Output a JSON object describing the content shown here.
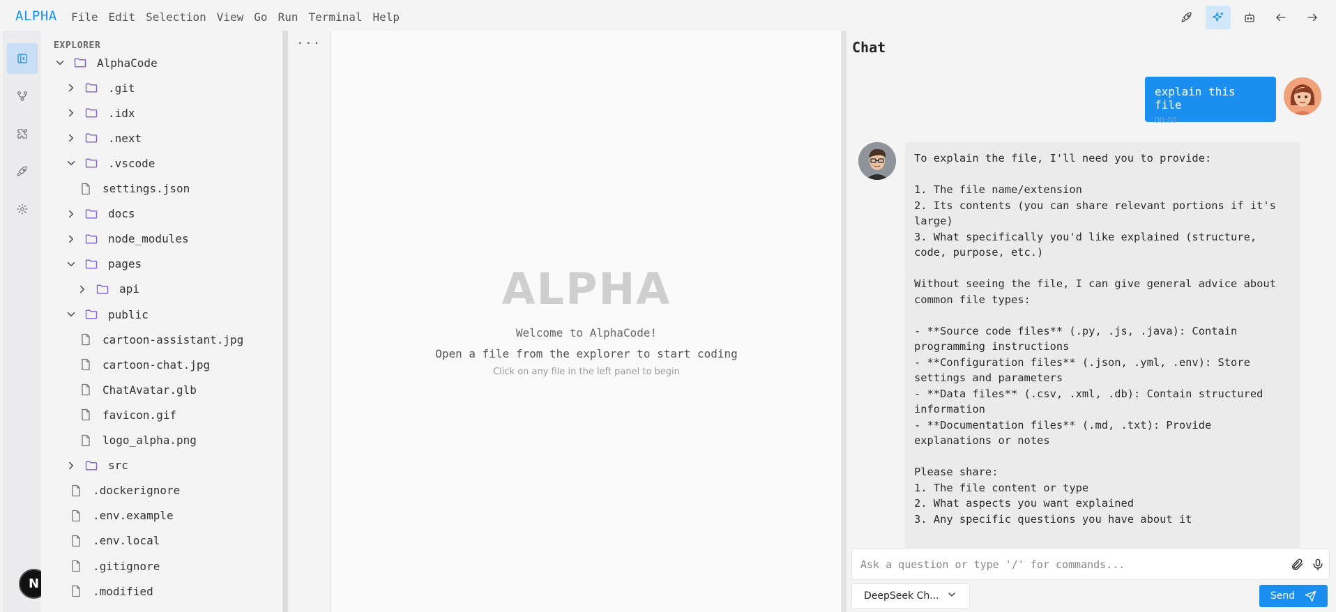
{
  "app": {
    "brand": "ALPHA"
  },
  "menu": [
    "File",
    "Edit",
    "Selection",
    "View",
    "Go",
    "Run",
    "Terminal",
    "Help"
  ],
  "top_icons": [
    "rocket-icon",
    "sparkles-icon",
    "bot-icon",
    "arrow-left-icon",
    "arrow-right-icon"
  ],
  "activity_icons": [
    "panel-left-icon",
    "git-branch-icon",
    "puzzle-icon",
    "rocket-icon",
    "gear-icon"
  ],
  "badge": {
    "letter": "N"
  },
  "explorer": {
    "title": "EXPLORER",
    "more": "···",
    "tree": [
      {
        "label": "AlphaCode",
        "kind": "folder",
        "depth": 0,
        "expanded": true
      },
      {
        "label": ".git",
        "kind": "folder",
        "depth": 1,
        "expanded": false
      },
      {
        "label": ".idx",
        "kind": "folder",
        "depth": 1,
        "expanded": false
      },
      {
        "label": ".next",
        "kind": "folder",
        "depth": 1,
        "expanded": false
      },
      {
        "label": ".vscode",
        "kind": "folder",
        "depth": 1,
        "expanded": true
      },
      {
        "label": "settings.json",
        "kind": "file",
        "depth": 2
      },
      {
        "label": "docs",
        "kind": "folder",
        "depth": 1,
        "expanded": false
      },
      {
        "label": "node_modules",
        "kind": "folder",
        "depth": 1,
        "expanded": false
      },
      {
        "label": "pages",
        "kind": "folder",
        "depth": 1,
        "expanded": true
      },
      {
        "label": "api",
        "kind": "folder",
        "depth": 2,
        "expanded": false
      },
      {
        "label": "public",
        "kind": "folder",
        "depth": 1,
        "expanded": true
      },
      {
        "label": "cartoon-assistant.jpg",
        "kind": "file",
        "depth": 2
      },
      {
        "label": "cartoon-chat.jpg",
        "kind": "file",
        "depth": 2
      },
      {
        "label": "ChatAvatar.glb",
        "kind": "file",
        "depth": 2
      },
      {
        "label": "favicon.gif",
        "kind": "file",
        "depth": 2
      },
      {
        "label": "logo_alpha.png",
        "kind": "file",
        "depth": 2
      },
      {
        "label": "src",
        "kind": "folder",
        "depth": 1,
        "expanded": false
      },
      {
        "label": ".dockerignore",
        "kind": "file",
        "depth": 1
      },
      {
        "label": ".env.example",
        "kind": "file",
        "depth": 1
      },
      {
        "label": ".env.local",
        "kind": "file",
        "depth": 1
      },
      {
        "label": ".gitignore",
        "kind": "file",
        "depth": 1
      },
      {
        "label": ".modified",
        "kind": "file",
        "depth": 1
      }
    ]
  },
  "editor": {
    "logo": "ALPHA",
    "welcome": "Welcome to AlphaCode!",
    "open_hint": "Open a file from the explorer to start coding",
    "click_hint": "Click on any file in the left panel to begin"
  },
  "chat": {
    "title": "Chat",
    "user_message": "explain this file",
    "user_time": "00:00",
    "assistant_lines": [
      "To explain the file, I'll need you to provide:",
      "",
      "1. The file name/extension",
      "2. Its contents (you can share relevant portions if it's",
      "large)",
      "3. What specifically you'd like explained (structure,",
      "code, purpose, etc.)",
      "",
      "Without seeing the file, I can give general advice about",
      "common file types:",
      "",
      "- **Source code files** (.py, .js, .java): Contain",
      "programming instructions",
      "- **Configuration files** (.json, .yml, .env): Store",
      "settings and parameters",
      "- **Data files** (.csv, .xml, .db): Contain structured",
      "information",
      "- **Documentation files** (.md, .txt): Provide",
      "explanations or notes",
      "",
      "Please share:",
      "1. The file content or type",
      "2. What aspects you want explained",
      "3. Any specific questions you have about it"
    ],
    "input_placeholder": "Ask a question or type '/' for commands...",
    "input_value": "",
    "model": "DeepSeek Ch...",
    "send_label": "Send"
  },
  "colors": {
    "accent": "#1a8ff0",
    "folder": "#7b5cd6",
    "user_bubble": "#1a8ff0",
    "assistant_bubble": "#ebebec"
  }
}
